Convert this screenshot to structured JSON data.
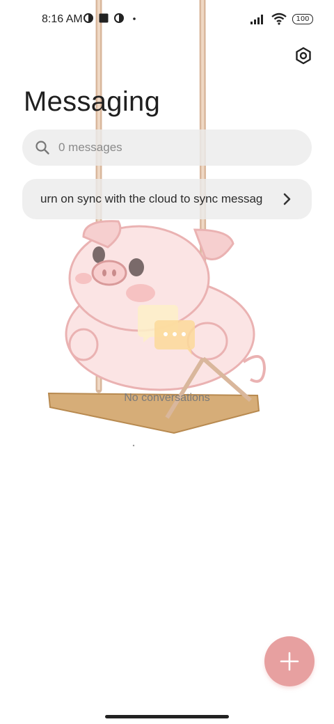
{
  "status_bar": {
    "time": "8:16 AM",
    "battery": "100",
    "icons": [
      "notification-icon",
      "square-icon",
      "notification-icon",
      "dot-icon",
      "signal-icon",
      "wifi-icon",
      "battery-icon"
    ]
  },
  "header": {
    "title": "Messaging",
    "settings_icon": "settings-icon"
  },
  "search": {
    "placeholder": "0 messages",
    "icon": "search-icon"
  },
  "sync_banner": {
    "text": "urn on sync with the cloud to sync messag",
    "icon": "chevron-right-icon"
  },
  "empty_state": {
    "text": "No conversations",
    "icon": "chat-bubbles-icon"
  },
  "fab": {
    "icon": "plus-icon",
    "color": "#e7a0a0"
  },
  "theme": {
    "accent": "#e7a0a0",
    "rope": "#d9b79c",
    "wood": "#c9a06a"
  }
}
